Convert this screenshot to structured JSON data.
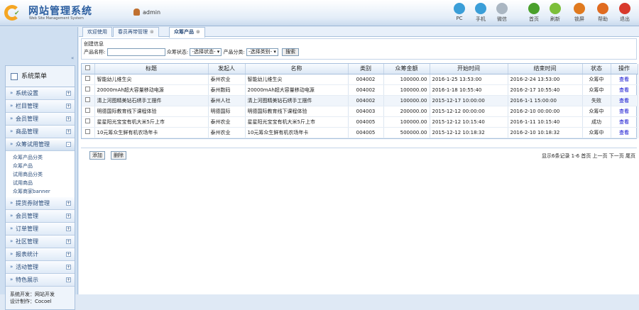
{
  "header": {
    "title": "网站管理系统",
    "subtitle": "Web Site Management System",
    "user": "admin",
    "buttons": [
      {
        "icon": "pc-icon",
        "label": "PC",
        "color": "#3a9ed8"
      },
      {
        "icon": "phone-icon",
        "label": "手机",
        "color": "#3a9ed8"
      },
      {
        "icon": "wechat-icon",
        "label": "微信",
        "color": "#aab6c2"
      },
      {
        "icon": "home-icon",
        "label": "首页",
        "color": "#4aa02c"
      },
      {
        "icon": "refresh-icon",
        "label": "刷新",
        "color": "#7cbf3a"
      },
      {
        "icon": "lock-icon",
        "label": "锁屏",
        "color": "#e07a1f"
      },
      {
        "icon": "help-icon",
        "label": "帮助",
        "color": "#e06b1f"
      },
      {
        "icon": "logout-icon",
        "label": "退出",
        "color": "#d83a2c"
      }
    ]
  },
  "sidebar": {
    "collapse": "«",
    "title": "系统菜单",
    "menus": [
      {
        "label": "系统设置"
      },
      {
        "label": "栏目管理"
      },
      {
        "label": "会员管理"
      },
      {
        "label": "商品管理"
      },
      {
        "label": "众筹试用管理",
        "open": true
      }
    ],
    "submenu": [
      "众筹产品分类",
      "众筹产品",
      "试用商品分类",
      "试用商品",
      "众筹商家banner"
    ],
    "menus_after": [
      {
        "label": "提货券财管理"
      },
      {
        "label": "会员管理"
      },
      {
        "label": "订单管理"
      },
      {
        "label": "社区管理"
      },
      {
        "label": "报表统计"
      },
      {
        "label": "活动管理"
      },
      {
        "label": "特色展示"
      }
    ],
    "credits": [
      "系统开发：网站开发",
      "设计制作：Cocoel"
    ]
  },
  "tabs": [
    {
      "label": "欢迎使用",
      "closable": false,
      "active": false
    },
    {
      "label": "春员再带管理",
      "closable": true,
      "active": false
    },
    {
      "label": "众筹产品",
      "closable": true,
      "active": true
    }
  ],
  "search": {
    "legend": "创建信息",
    "product_label": "产品名称:",
    "product_value": "",
    "status_label": "众筹状态:",
    "status_value": "-选择状态- ▾",
    "category_label": "产品分类:",
    "category_value": "-选择类别- ▾",
    "button": "搜索"
  },
  "table": {
    "columns": [
      "",
      "标题",
      "发起人",
      "名称",
      "类别",
      "众筹金额",
      "开始时间",
      "结束时间",
      "状态",
      "操作"
    ],
    "rows": [
      [
        "",
        "智能幼儿维生尖",
        "泰州农业",
        "智能幼儿维生尖",
        "004002",
        "100000.00",
        "2016-1-25 13:53:00",
        "2016-2-24 13:53:00",
        "众筹中",
        "查看"
      ],
      [
        "",
        "20000mAh超大容量移动电源",
        "泰州数码",
        "20000mAh超大容量移动电源",
        "004002",
        "100000.00",
        "2016-1-18 10:55:40",
        "2016-2-17 10:55:40",
        "众筹中",
        "查看"
      ],
      [
        "",
        "清上河图精美钻石绣手工摆件",
        "泰州人社",
        "清上河图精美钻石绣手工摆件",
        "004002",
        "100000.00",
        "2015-12-17 10:00:00",
        "2016-1-1 15:00:00",
        "失败",
        "查看"
      ],
      [
        "",
        "明德国际教育线下课程体验",
        "明德国际",
        "明德国际教育线下课程体验",
        "004003",
        "200000.00",
        "2015-12-12 00:00:00",
        "2016-2-10 00:00:00",
        "众筹中",
        "查看"
      ],
      [
        "",
        "星星阳光宝宝有机大米5斤上市",
        "泰州农业",
        "星星阳光宝宝有机大米5斤上市",
        "004005",
        "100000.00",
        "2015-12-12 10:15:40",
        "2016-1-11 10:15:40",
        "成功",
        "查看"
      ],
      [
        "",
        "10元筹众生鲜有机农场年卡",
        "泰州农业",
        "10元筹众生鲜有机农场年卡",
        "004005",
        "500000.00",
        "2015-12-12 10:18:32",
        "2016-2-10 10:18:32",
        "众筹中",
        "查看"
      ]
    ]
  },
  "actions": {
    "add": "添加",
    "delete": "删除",
    "pager": "显示6条记录 1-6  首页  上一页  下一页  尾页"
  }
}
